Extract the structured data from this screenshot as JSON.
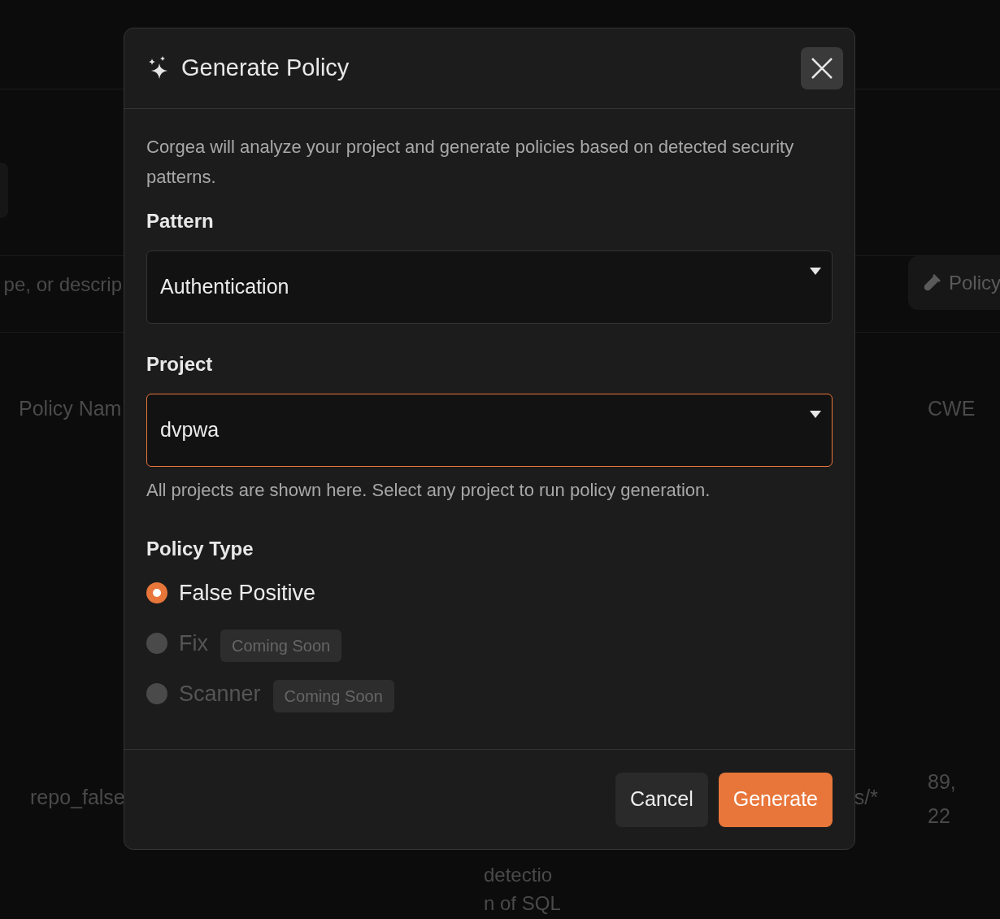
{
  "background": {
    "search_placeholder": "pe, or descrip",
    "policy_button": "Policy",
    "table": {
      "columns": [
        "Policy Nam",
        "CWE"
      ],
      "rows": [
        {
          "name": "repo_false",
          "description": [
            "detectio",
            "n of SQL"
          ],
          "pattern": "s/*",
          "cwe": [
            "89,",
            "22"
          ]
        }
      ]
    }
  },
  "dialog": {
    "title": "Generate Policy",
    "description": "Corgea will analyze your project and generate policies based on detected security patterns.",
    "pattern": {
      "label": "Pattern",
      "value": "Authentication",
      "focused": false
    },
    "project": {
      "label": "Project",
      "value": "dvpwa",
      "focused": true,
      "help": "All projects are shown here. Select any project to run policy generation."
    },
    "policy_type": {
      "label": "Policy Type",
      "options": [
        {
          "label": "False Positive",
          "selected": true,
          "disabled": false
        },
        {
          "label": "Fix",
          "selected": false,
          "disabled": true,
          "badge": "Coming Soon"
        },
        {
          "label": "Scanner",
          "selected": false,
          "disabled": true,
          "badge": "Coming Soon"
        }
      ]
    },
    "buttons": {
      "cancel": "Cancel",
      "generate": "Generate"
    }
  }
}
